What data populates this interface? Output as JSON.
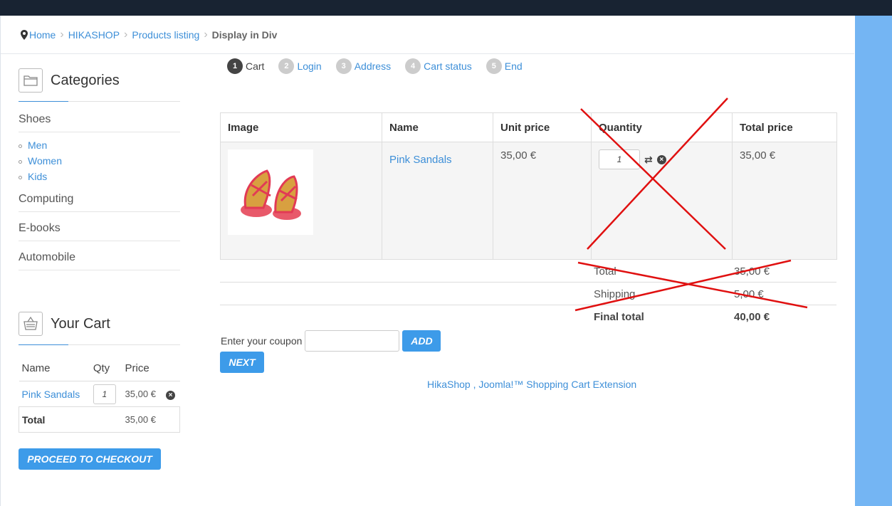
{
  "breadcrumb": {
    "home": "Home",
    "items": [
      "HIKASHOP",
      "Products listing"
    ],
    "current": "Display in Div"
  },
  "categories_module": {
    "title": "Categories",
    "items": [
      {
        "label": "Shoes",
        "children": [
          "Men",
          "Women",
          "Kids"
        ]
      },
      {
        "label": "Computing"
      },
      {
        "label": "E-books"
      },
      {
        "label": "Automobile"
      }
    ]
  },
  "cart_module": {
    "title": "Your Cart",
    "headers": [
      "Name",
      "Qty",
      "Price"
    ],
    "rows": [
      {
        "name": "Pink Sandals",
        "qty": "1",
        "price": "35,00 €"
      }
    ],
    "total_label": "Total",
    "total_value": "35,00 €",
    "checkout_label": "PROCEED TO CHECKOUT"
  },
  "steps": [
    {
      "num": "1",
      "label": "Cart",
      "active": true
    },
    {
      "num": "2",
      "label": "Login"
    },
    {
      "num": "3",
      "label": "Address"
    },
    {
      "num": "4",
      "label": "Cart status"
    },
    {
      "num": "5",
      "label": "End"
    }
  ],
  "cart_table": {
    "headers": [
      "Image",
      "Name",
      "Unit price",
      "Quantity",
      "Total price"
    ],
    "rows": [
      {
        "name": "Pink Sandals",
        "unit_price": "35,00 €",
        "qty": "1",
        "total_price": "35,00 €"
      }
    ]
  },
  "totals": {
    "total_label": "Total",
    "total_value": "35,00 €",
    "shipping_label": "Shipping",
    "shipping_value": "5,00 €",
    "final_label": "Final total",
    "final_value": "40,00 €"
  },
  "coupon": {
    "label": "Enter your coupon",
    "value": "",
    "add_label": "ADD"
  },
  "next_label": "NEXT",
  "footer_link": "HikaShop , Joomla!™ Shopping Cart Extension",
  "colors": {
    "topbar": "#182332",
    "accent_blue": "#3d9be9",
    "right_panel": "#74b5f3",
    "annotation_red": "#e01010"
  },
  "icons": [
    "map-marker-icon",
    "folder-icon",
    "basket-icon",
    "remove-icon",
    "refresh-icon"
  ]
}
